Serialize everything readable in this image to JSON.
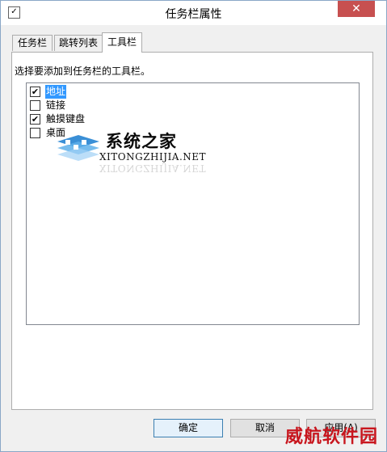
{
  "window": {
    "title": "任务栏属性",
    "close_glyph": "✕"
  },
  "tabs": [
    {
      "label": "任务栏"
    },
    {
      "label": "跳转列表"
    },
    {
      "label": "工具栏"
    }
  ],
  "toolbars_tab": {
    "instruction": "选择要添加到任务栏的工具栏。",
    "items": [
      {
        "label": "地址",
        "checked": true,
        "selected": true
      },
      {
        "label": "链接",
        "checked": false,
        "selected": false
      },
      {
        "label": "触摸键盘",
        "checked": true,
        "selected": false
      },
      {
        "label": "桌面",
        "checked": false,
        "selected": false
      }
    ]
  },
  "watermark": {
    "title": "系统之家",
    "url": "XITONGZHIJIA.NET"
  },
  "buttons": {
    "ok": "确定",
    "cancel": "取消",
    "apply": "应用(A)"
  },
  "brand_stamp": "威航软件园",
  "colors": {
    "selection": "#3399ff",
    "close_button": "#c75050",
    "stamp": "#c8161e"
  }
}
